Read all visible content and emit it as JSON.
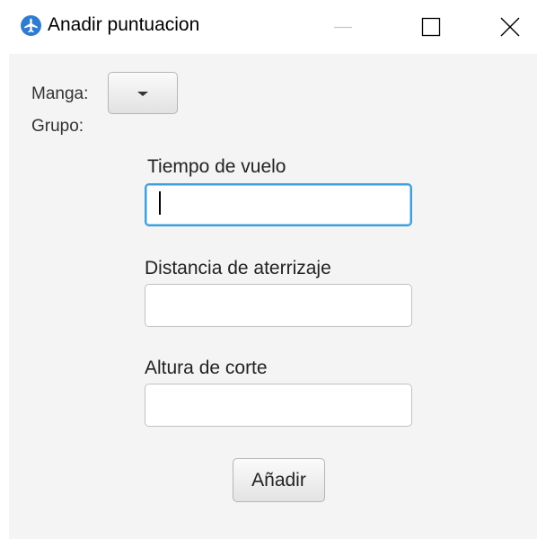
{
  "window": {
    "title": "Anadir puntuacion",
    "icon": "airplane-icon",
    "accent_color": "#2f7bd0"
  },
  "form": {
    "manga_label": "Manga:",
    "grupo_label": "Grupo:",
    "manga_selected": "",
    "fields": [
      {
        "label": "Tiempo de vuelo",
        "value": ""
      },
      {
        "label": "Distancia de aterrizaje",
        "value": ""
      },
      {
        "label": "Altura de corte",
        "value": ""
      }
    ],
    "submit_label": "Añadir"
  }
}
